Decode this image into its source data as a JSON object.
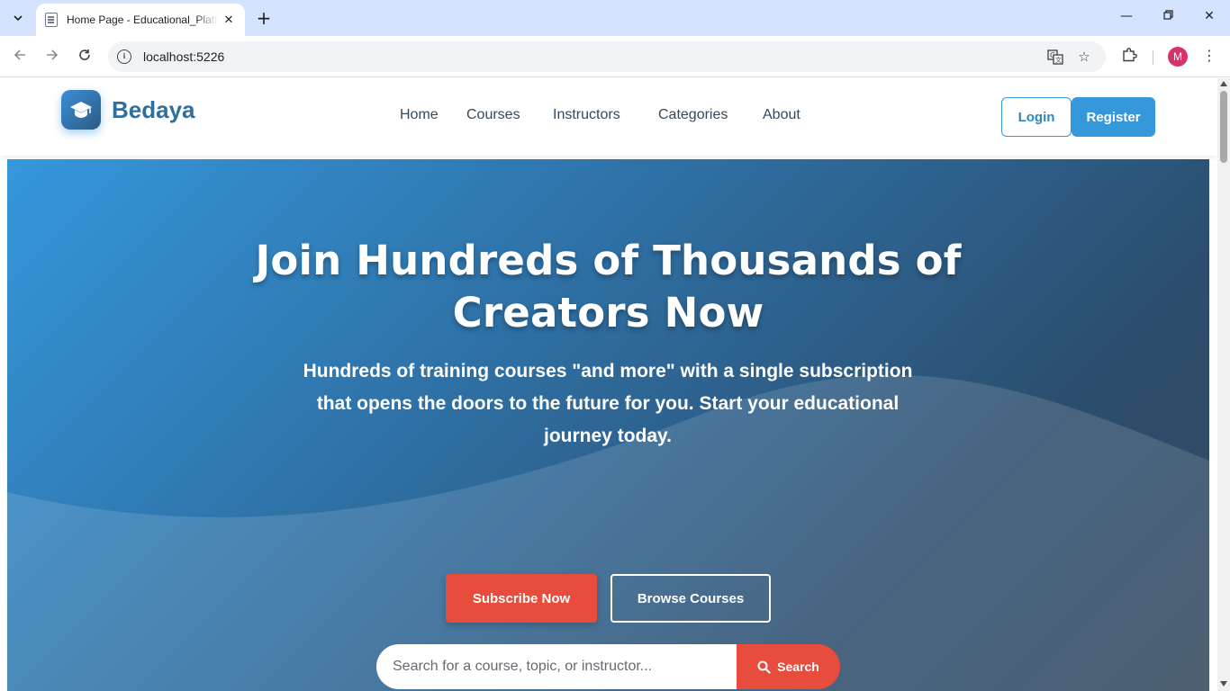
{
  "browser": {
    "tab_title": "Home Page - Educational_Platform",
    "url": "localhost:5226",
    "profile_initial": "M"
  },
  "site": {
    "brand": "Bedaya",
    "nav": [
      "Home",
      "Courses",
      "Instructors",
      "Categories",
      "About"
    ],
    "login_label": "Login",
    "register_label": "Register"
  },
  "hero": {
    "title_line1": "Join Hundreds of Thousands of",
    "title_line2": "Creators Now",
    "subtitle": "Hundreds of training courses \"and more\" with a single subscription that opens the doors to the future for you. Start your educational journey today.",
    "subscribe_label": "Subscribe Now",
    "browse_label": "Browse Courses",
    "search_placeholder": "Search for a course, topic, or instructor...",
    "search_button": "Search"
  },
  "colors": {
    "primary": "#3498db",
    "accent": "#e74c3c",
    "dark": "#34495e"
  },
  "icons": {
    "logo": "graduation-cap-icon",
    "search": "search-icon"
  }
}
